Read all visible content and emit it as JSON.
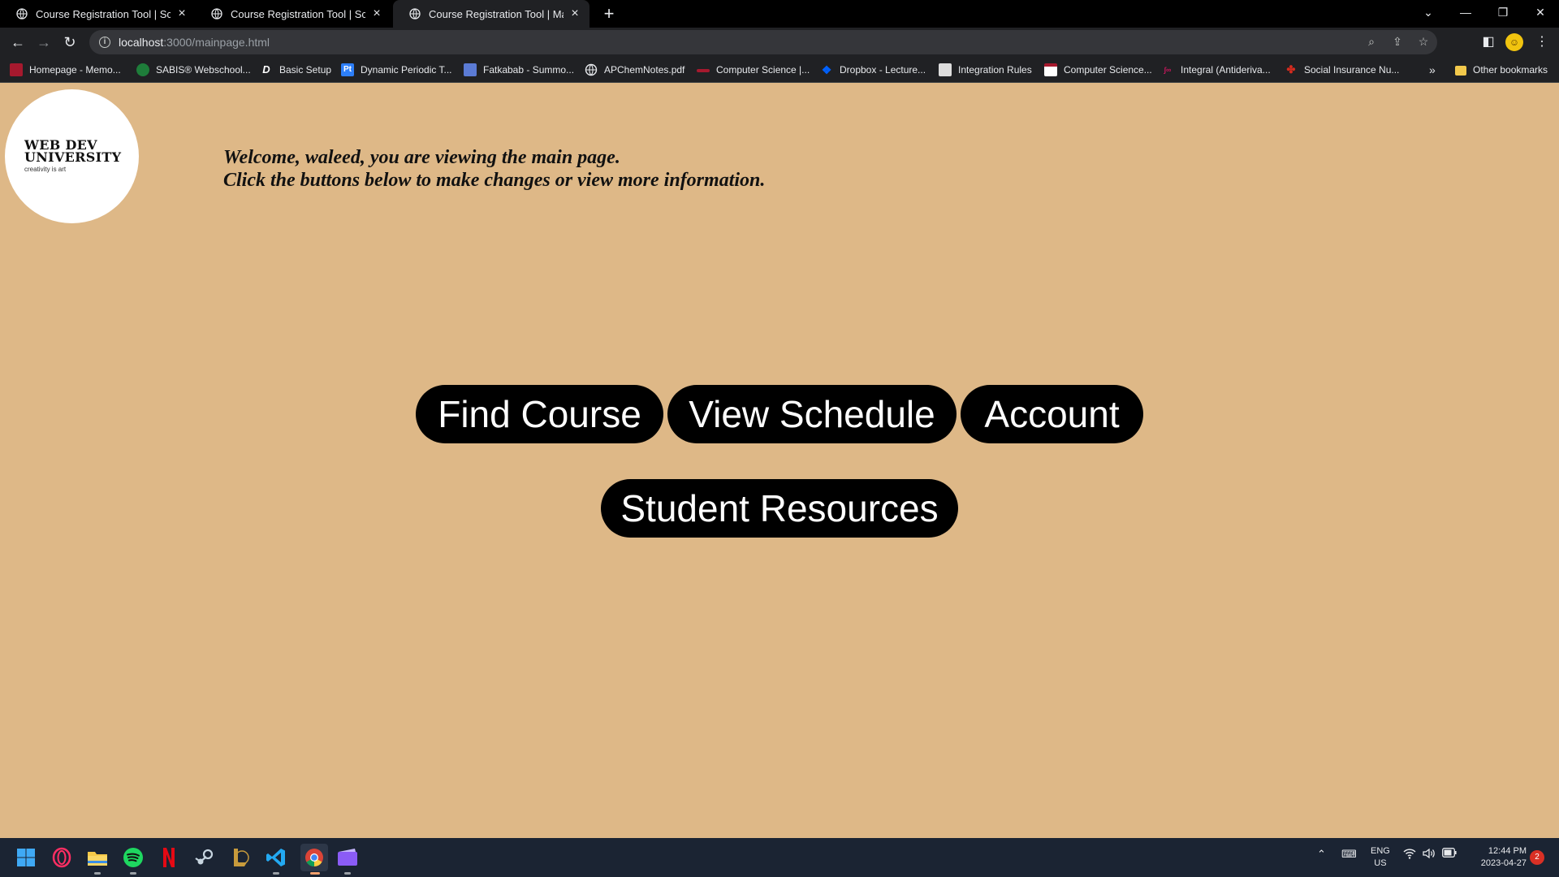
{
  "browser": {
    "tabs": [
      {
        "title": "Course Registration Tool | Schedule",
        "active": false
      },
      {
        "title": "Course Registration Tool | Schedule",
        "active": false
      },
      {
        "title": "Course Registration Tool | Main",
        "active": true
      }
    ],
    "new_tab_label": "+",
    "address": {
      "host": "localhost",
      "path": ":3000/mainpage.html"
    },
    "bookmarks": [
      {
        "label": "Homepage - Memo...",
        "icon": "memorial-icon",
        "color": "#a6192e"
      },
      {
        "label": "SABIS® Webschool...",
        "icon": "sabis-icon",
        "color": "#1e7d3a"
      },
      {
        "label": "Basic Setup",
        "icon": "d-icon",
        "color": "#202124"
      },
      {
        "label": "Dynamic Periodic T...",
        "icon": "periodic-table-icon",
        "color": "#2d7ff9"
      },
      {
        "label": "Fatkabab - Summo...",
        "icon": "fatkabab-icon",
        "color": "#5b7bd5"
      },
      {
        "label": "APChemNotes.pdf",
        "icon": "globe-icon",
        "color": "#202124"
      },
      {
        "label": "Computer Science |...",
        "icon": "cs-icon",
        "color": "#a6192e"
      },
      {
        "label": "Dropbox - Lecture...",
        "icon": "dropbox-icon",
        "color": "#0061fe"
      },
      {
        "label": "Integration Rules",
        "icon": "integration-icon",
        "color": "#dddddd"
      },
      {
        "label": "Computer Science...",
        "icon": "cs2-icon",
        "color": "#a6192e"
      },
      {
        "label": "Integral (Antideriva...",
        "icon": "integral-icon",
        "color": "#c2185b"
      },
      {
        "label": "Social Insurance Nu...",
        "icon": "maple-leaf-icon",
        "color": "#d52b1e"
      }
    ],
    "more_bookmarks": "»",
    "other_bookmarks": "Other bookmarks"
  },
  "page": {
    "logo": {
      "line1": "WEB DEV",
      "line2": "UNIVERSITY",
      "tagline": "creativity is art"
    },
    "welcome_line1": "Welcome, waleed, you are viewing the main page.",
    "welcome_line2": "Click the buttons below to make changes or view more information.",
    "buttons": {
      "find_course": "Find Course",
      "view_schedule": "View Schedule",
      "account": "Account",
      "student_resources": "Student Resources"
    },
    "background_color": "#deb887",
    "button_color": "#000000"
  },
  "taskbar": {
    "apps": [
      "windows-start-icon",
      "opera-gx-icon",
      "file-explorer-icon",
      "spotify-icon",
      "netflix-icon",
      "steam-icon",
      "league-of-legends-icon",
      "vscode-icon",
      "chrome-icon",
      "clipchamp-icon"
    ],
    "language": {
      "line1": "ENG",
      "line2": "US"
    },
    "time": "12:44 PM",
    "date": "2023-04-27",
    "notification_count": "2"
  }
}
